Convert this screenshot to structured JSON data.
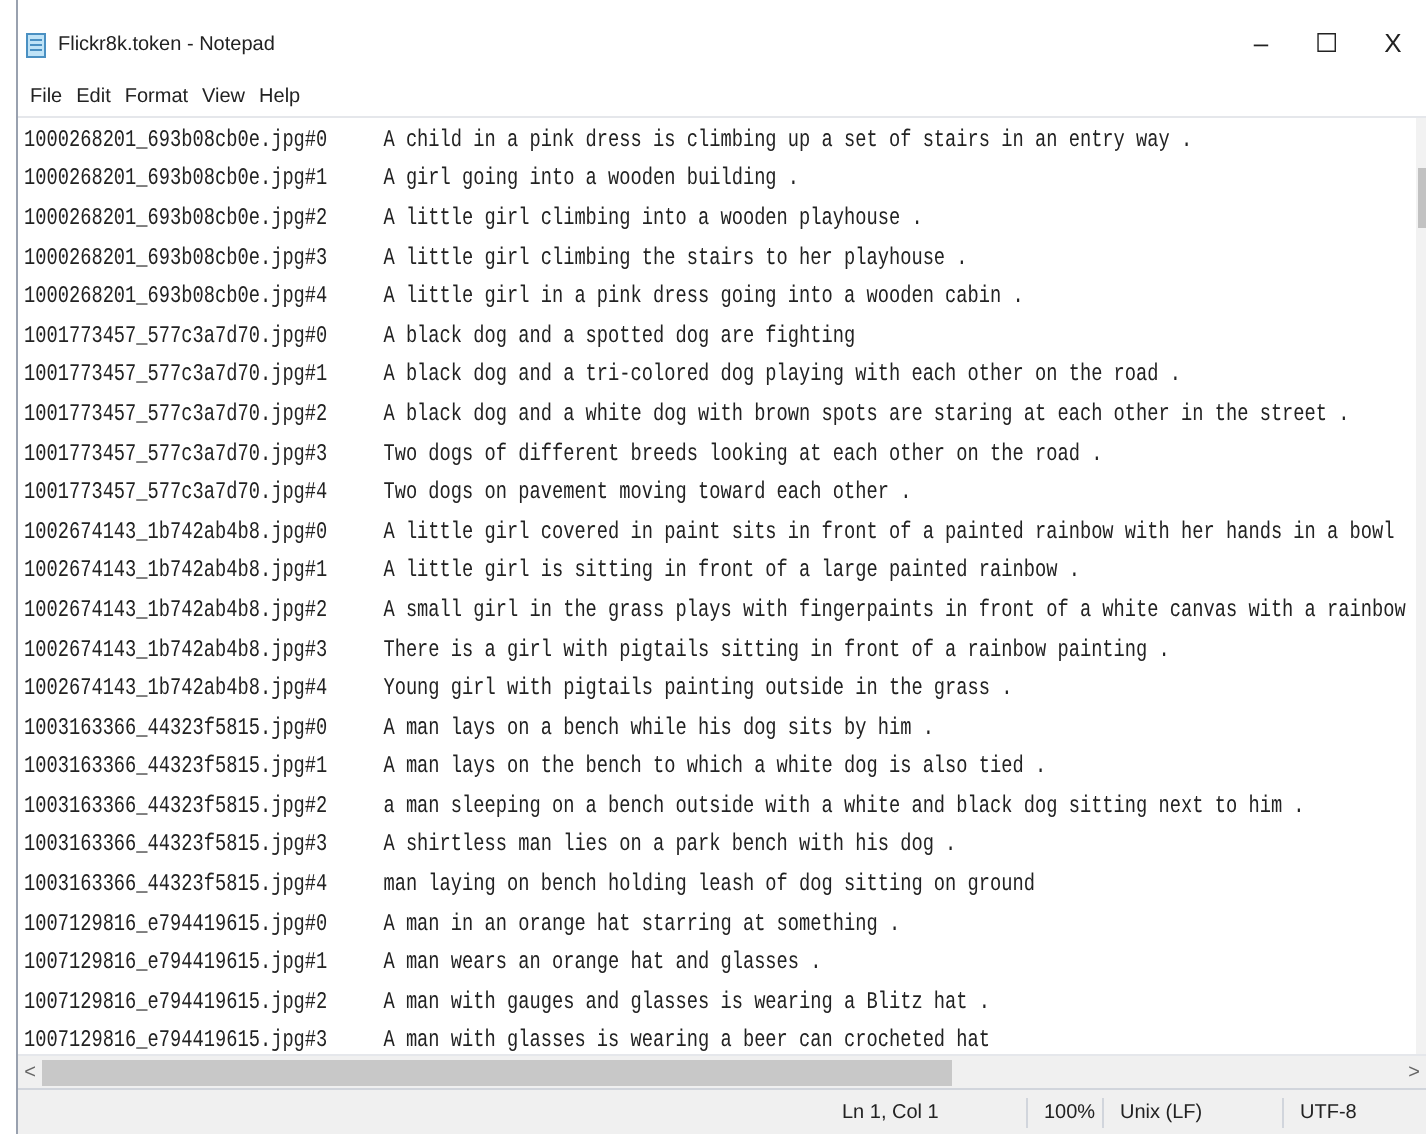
{
  "window": {
    "title": "Flickr8k.token - Notepad",
    "controls": [
      "–",
      "☐",
      "X"
    ]
  },
  "menu": [
    "File",
    "Edit",
    "Format",
    "View",
    "Help"
  ],
  "lines": [
    {
      "image": "1000268201_693b08cb0e.jpg#0",
      "caption": "A child in a pink dress is climbing up a set of stairs in an entry way ."
    },
    {
      "image": "1000268201_693b08cb0e.jpg#1",
      "caption": "A girl going into a wooden building ."
    },
    {
      "image": "1000268201_693b08cb0e.jpg#2",
      "caption": "A little girl climbing into a wooden playhouse ."
    },
    {
      "image": "1000268201_693b08cb0e.jpg#3",
      "caption": "A little girl climbing the stairs to her playhouse ."
    },
    {
      "image": "1000268201_693b08cb0e.jpg#4",
      "caption": "A little girl in a pink dress going into a wooden cabin ."
    },
    {
      "image": "1001773457_577c3a7d70.jpg#0",
      "caption": "A black dog and a spotted dog are fighting"
    },
    {
      "image": "1001773457_577c3a7d70.jpg#1",
      "caption": "A black dog and a tri-colored dog playing with each other on the road ."
    },
    {
      "image": "1001773457_577c3a7d70.jpg#2",
      "caption": "A black dog and a white dog with brown spots are staring at each other in the street ."
    },
    {
      "image": "1001773457_577c3a7d70.jpg#3",
      "caption": "Two dogs of different breeds looking at each other on the road ."
    },
    {
      "image": "1001773457_577c3a7d70.jpg#4",
      "caption": "Two dogs on pavement moving toward each other ."
    },
    {
      "image": "1002674143_1b742ab4b8.jpg#0",
      "caption": "A little girl covered in paint sits in front of a painted rainbow with her hands in a bowl"
    },
    {
      "image": "1002674143_1b742ab4b8.jpg#1",
      "caption": "A little girl is sitting in front of a large painted rainbow ."
    },
    {
      "image": "1002674143_1b742ab4b8.jpg#2",
      "caption": "A small girl in the grass plays with fingerpaints in front of a white canvas with a rainbow"
    },
    {
      "image": "1002674143_1b742ab4b8.jpg#3",
      "caption": "There is a girl with pigtails sitting in front of a rainbow painting ."
    },
    {
      "image": "1002674143_1b742ab4b8.jpg#4",
      "caption": "Young girl with pigtails painting outside in the grass ."
    },
    {
      "image": "1003163366_44323f5815.jpg#0",
      "caption": "A man lays on a bench while his dog sits by him ."
    },
    {
      "image": "1003163366_44323f5815.jpg#1",
      "caption": "A man lays on the bench to which a white dog is also tied ."
    },
    {
      "image": "1003163366_44323f5815.jpg#2",
      "caption": "a man sleeping on a bench outside with a white and black dog sitting next to him ."
    },
    {
      "image": "1003163366_44323f5815.jpg#3",
      "caption": "A shirtless man lies on a park bench with his dog ."
    },
    {
      "image": "1003163366_44323f5815.jpg#4",
      "caption": "man laying on bench holding leash of dog sitting on ground"
    },
    {
      "image": "1007129816_e794419615.jpg#0",
      "caption": "A man in an orange hat starring at something ."
    },
    {
      "image": "1007129816_e794419615.jpg#1",
      "caption": "A man wears an orange hat and glasses ."
    },
    {
      "image": "1007129816_e794419615.jpg#2",
      "caption": "A man with gauges and glasses is wearing a Blitz hat ."
    },
    {
      "image": "1007129816_e794419615.jpg#3",
      "caption": "A man with glasses is wearing a beer can crocheted hat"
    }
  ],
  "scroll_arrows": [
    "<",
    ">"
  ],
  "status_bar": {
    "position": "Ln 1, Col 1",
    "zoom": "100%",
    "line_ending": "Unix (LF)",
    "encoding": "UTF-8"
  }
}
